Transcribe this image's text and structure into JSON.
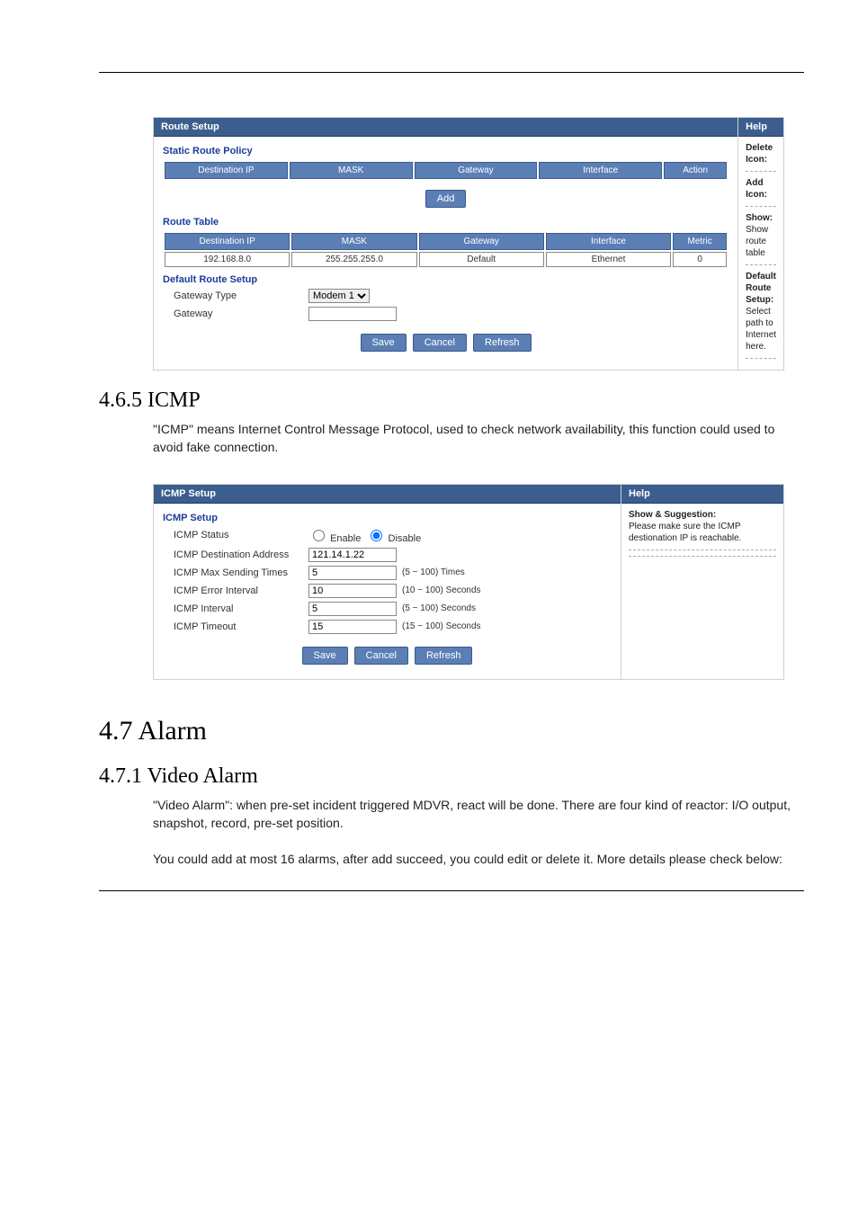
{
  "route_panel": {
    "title": "Route Setup",
    "static_policy_label": "Static Route Policy",
    "headers": [
      "Destination IP",
      "MASK",
      "Gateway",
      "Interface",
      "Action"
    ],
    "add_button": "Add",
    "route_table_label": "Route Table",
    "table_headers": [
      "Destination IP",
      "MASK",
      "Gateway",
      "Interface",
      "Metric"
    ],
    "row": [
      "192.168.8.0",
      "255.255.255.0",
      "Default",
      "Ethernet",
      "0"
    ],
    "default_route_label": "Default Route Setup",
    "gateway_type_label": "Gateway Type",
    "gateway_type_value": "Modem 1",
    "gateway_label": "Gateway",
    "gateway_value": "",
    "buttons": {
      "save": "Save",
      "cancel": "Cancel",
      "refresh": "Refresh"
    },
    "help": {
      "title": "Help",
      "delete_icon": "Delete Icon:",
      "add_icon": "Add Icon:",
      "show_label": "Show:",
      "show_text": "Show route table",
      "default_route_label": "Default Route Setup:",
      "default_route_text": "Select path to Internet here."
    }
  },
  "section_icmp": {
    "heading": "4.6.5 ICMP",
    "para": "\"ICMP\" means Internet Control Message Protocol, used to check network availability, this function could used to avoid fake connection."
  },
  "icmp_panel": {
    "title": "ICMP Setup",
    "section_label": "ICMP Setup",
    "status_label": "ICMP Status",
    "enable_label": "Enable",
    "disable_label": "Disable",
    "dest_label": "ICMP Destination Address",
    "dest_value": "121.14.1.22",
    "max_label": "ICMP Max Sending Times",
    "max_value": "5",
    "max_unit": "(5 ~ 100) Times",
    "err_label": "ICMP Error Interval",
    "err_value": "10",
    "err_unit": "(10 ~ 100) Seconds",
    "interval_label": "ICMP Interval",
    "interval_value": "5",
    "interval_unit": "(5 ~ 100) Seconds",
    "timeout_label": "ICMP Timeout",
    "timeout_value": "15",
    "timeout_unit": "(15 ~ 100) Seconds",
    "buttons": {
      "save": "Save",
      "cancel": "Cancel",
      "refresh": "Refresh"
    },
    "help": {
      "title": "Help",
      "sugg_label": "Show  & Suggestion:",
      "sugg_text": "Please make sure the ICMP destionation IP is reachable."
    }
  },
  "section_alarm": {
    "heading": "4.7 Alarm"
  },
  "section_video_alarm": {
    "heading": "4.7.1 Video Alarm",
    "para1": "\"Video Alarm\": when pre-set incident triggered MDVR, react will be done. There are four kind of reactor: I/O output, snapshot, record, pre-set position.",
    "para2": "You could add at most 16 alarms, after add succeed, you could edit or delete it. More details please check below:"
  },
  "chart_data": {
    "type": "table",
    "title": "Route Table",
    "columns": [
      "Destination IP",
      "MASK",
      "Gateway",
      "Interface",
      "Metric"
    ],
    "rows": [
      [
        "192.168.8.0",
        "255.255.255.0",
        "Default",
        "Ethernet",
        0
      ]
    ]
  }
}
